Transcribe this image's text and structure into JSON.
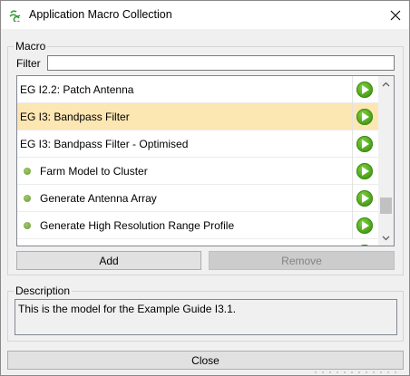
{
  "window": {
    "title": "Application Macro Collection",
    "close_glyph": "✕"
  },
  "macro_group": {
    "label": "Macro",
    "filter_label": "Filter",
    "filter_value": "",
    "items": [
      {
        "label": "EG I2.2: Patch Antenna",
        "type": "macro",
        "selected": false,
        "icon": "play-icon"
      },
      {
        "label": "EG I3: Bandpass Filter",
        "type": "macro",
        "selected": true,
        "icon": "play-icon"
      },
      {
        "label": "EG I3: Bandpass Filter  - Optimised",
        "type": "macro",
        "selected": false,
        "icon": "play-icon"
      },
      {
        "label": "Farm Model to Cluster",
        "type": "sub-macro",
        "selected": false,
        "icon": "play-icon"
      },
      {
        "label": "Generate Antenna Array",
        "type": "sub-macro",
        "selected": false,
        "icon": "play-icon"
      },
      {
        "label": "Generate High Resolution Range Profile",
        "type": "sub-macro",
        "selected": false,
        "icon": "play-icon"
      }
    ],
    "add_label": "Add",
    "remove_label": "Remove"
  },
  "description_group": {
    "label": "Description",
    "text": "This is the model for the Example Guide I3.1."
  },
  "close_label": "Close",
  "colors": {
    "selected_row": "#fce6b2",
    "play_green": "#4aa01b",
    "window_bg": "#f0f0f0"
  }
}
